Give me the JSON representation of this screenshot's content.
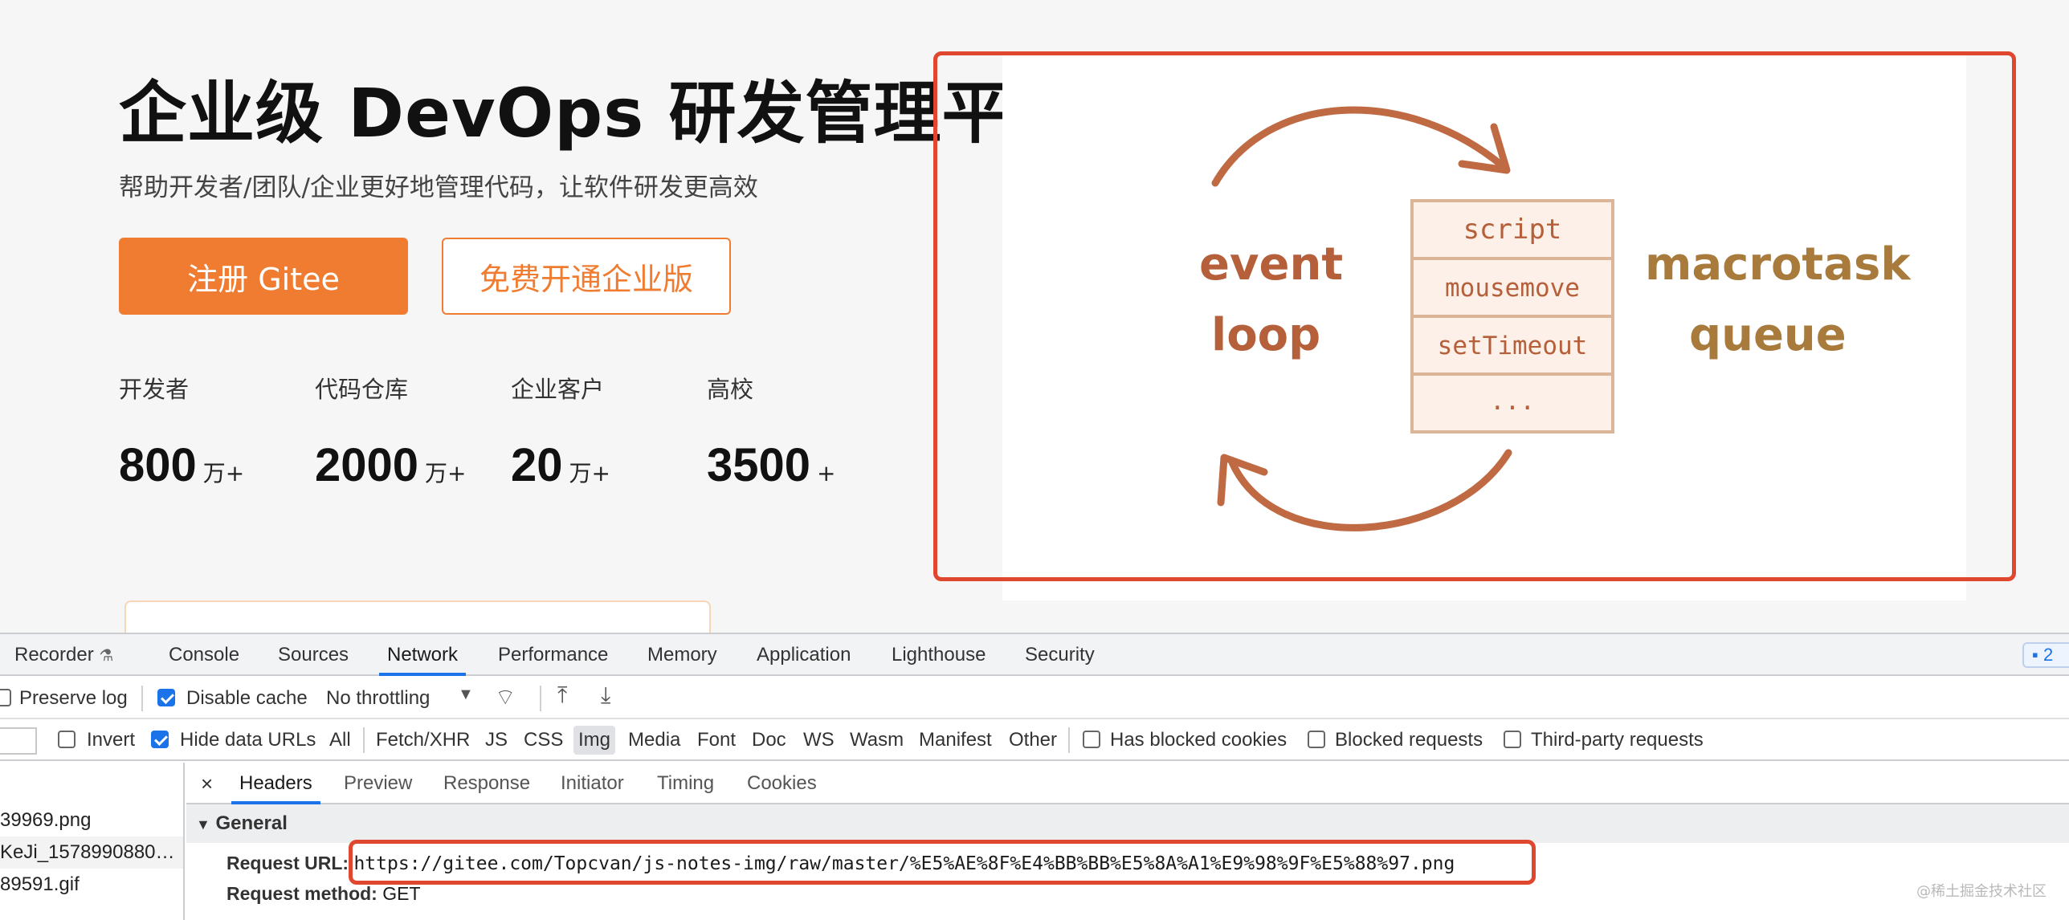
{
  "hero": {
    "title": "企业级 DevOps 研发管理平台",
    "subtitle": "帮助开发者/团队/企业更好地管理代码，让软件研发更高效",
    "primary_button": "注册 Gitee",
    "secondary_button": "免费开通企业版",
    "stats": [
      {
        "label": "开发者",
        "value": "800",
        "unit": "万+"
      },
      {
        "label": "代码仓库",
        "value": "2000",
        "unit": "万+"
      },
      {
        "label": "企业客户",
        "value": "20",
        "unit": "万+"
      },
      {
        "label": "高校",
        "value": "3500",
        "unit": "+"
      }
    ]
  },
  "illustration": {
    "left_label_1": "event",
    "left_label_2": "loop",
    "right_label_1": "macrotask",
    "right_label_2": "queue",
    "queue_items": [
      "script",
      "mousemove",
      "setTimeout",
      "..."
    ],
    "colors": {
      "arrow": "#c06a44",
      "event_text": "#b5603a",
      "macrotask_text": "#a87a3c",
      "box_fill": "#fdf0e8",
      "box_stroke": "#dbb597",
      "highlight": "#e0472f"
    }
  },
  "devtools": {
    "tabs": [
      "Recorder",
      "Console",
      "Sources",
      "Network",
      "Performance",
      "Memory",
      "Application",
      "Lighthouse",
      "Security"
    ],
    "active_tab": "Network",
    "issues_count": "2",
    "toolbar": {
      "preserve_log": "Preserve log",
      "disable_cache": "Disable cache",
      "throttling": "No throttling"
    },
    "filters": {
      "invert": "Invert",
      "hide_data_urls": "Hide data URLs",
      "types": [
        "All",
        "Fetch/XHR",
        "JS",
        "CSS",
        "Img",
        "Media",
        "Font",
        "Doc",
        "WS",
        "Wasm",
        "Manifest",
        "Other"
      ],
      "active_type": "Img",
      "has_blocked_cookies": "Has blocked cookies",
      "blocked_requests": "Blocked requests",
      "third_party": "Third-party requests"
    },
    "requests": [
      "39969.png",
      "KeJi_1578990880…",
      "89591.gif"
    ],
    "detail_tabs": [
      "Headers",
      "Preview",
      "Response",
      "Initiator",
      "Timing",
      "Cookies"
    ],
    "active_detail_tab": "Headers",
    "general": {
      "title": "General",
      "request_url_label": "Request URL:",
      "request_url": "https://gitee.com/Topcvan/js-notes-img/raw/master/%E5%AE%8F%E4%BB%BB%E5%8A%A1%E9%98%9F%E5%88%97.png",
      "request_method_label": "Request method:",
      "request_method": "GET"
    }
  },
  "watermark": "@稀土掘金技术社区"
}
